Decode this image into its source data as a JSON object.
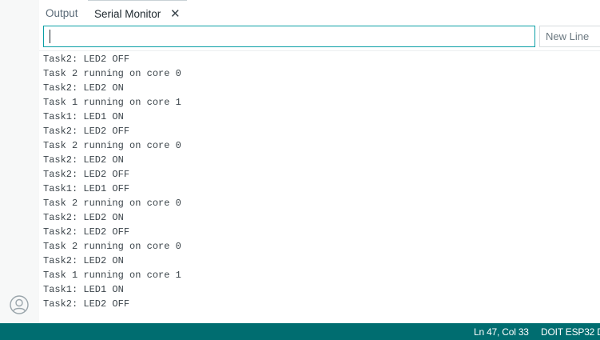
{
  "tabs": [
    {
      "label": "Output",
      "active": false
    },
    {
      "label": "Serial Monitor",
      "active": true,
      "close_icon": "close-icon"
    }
  ],
  "send_input": {
    "value": ""
  },
  "line_ending": {
    "value": "New Line"
  },
  "console": {
    "lines": [
      "Task2: LED2 OFF",
      "Task 2 running on core 0",
      "Task2: LED2 ON",
      "Task 1 running on core 1",
      "Task1: LED1 ON",
      "Task2: LED2 OFF",
      "Task 2 running on core 0",
      "Task2: LED2 ON",
      "Task2: LED2 OFF",
      "Task1: LED1 OFF",
      "Task 2 running on core 0",
      "Task2: LED2 ON",
      "Task2: LED2 OFF",
      "Task 2 running on core 0",
      "Task2: LED2 ON",
      "Task 1 running on core 1",
      "Task1: LED1 ON",
      "Task2: LED2 OFF"
    ]
  },
  "status_bar": {
    "position": "Ln 47, Col 33",
    "board": "DOIT ESP32 D"
  },
  "icons": {
    "account": "account-icon",
    "close": "close-icon"
  },
  "colors": {
    "status_bar": "#006d70",
    "input_focus": "#0a9fa6"
  }
}
